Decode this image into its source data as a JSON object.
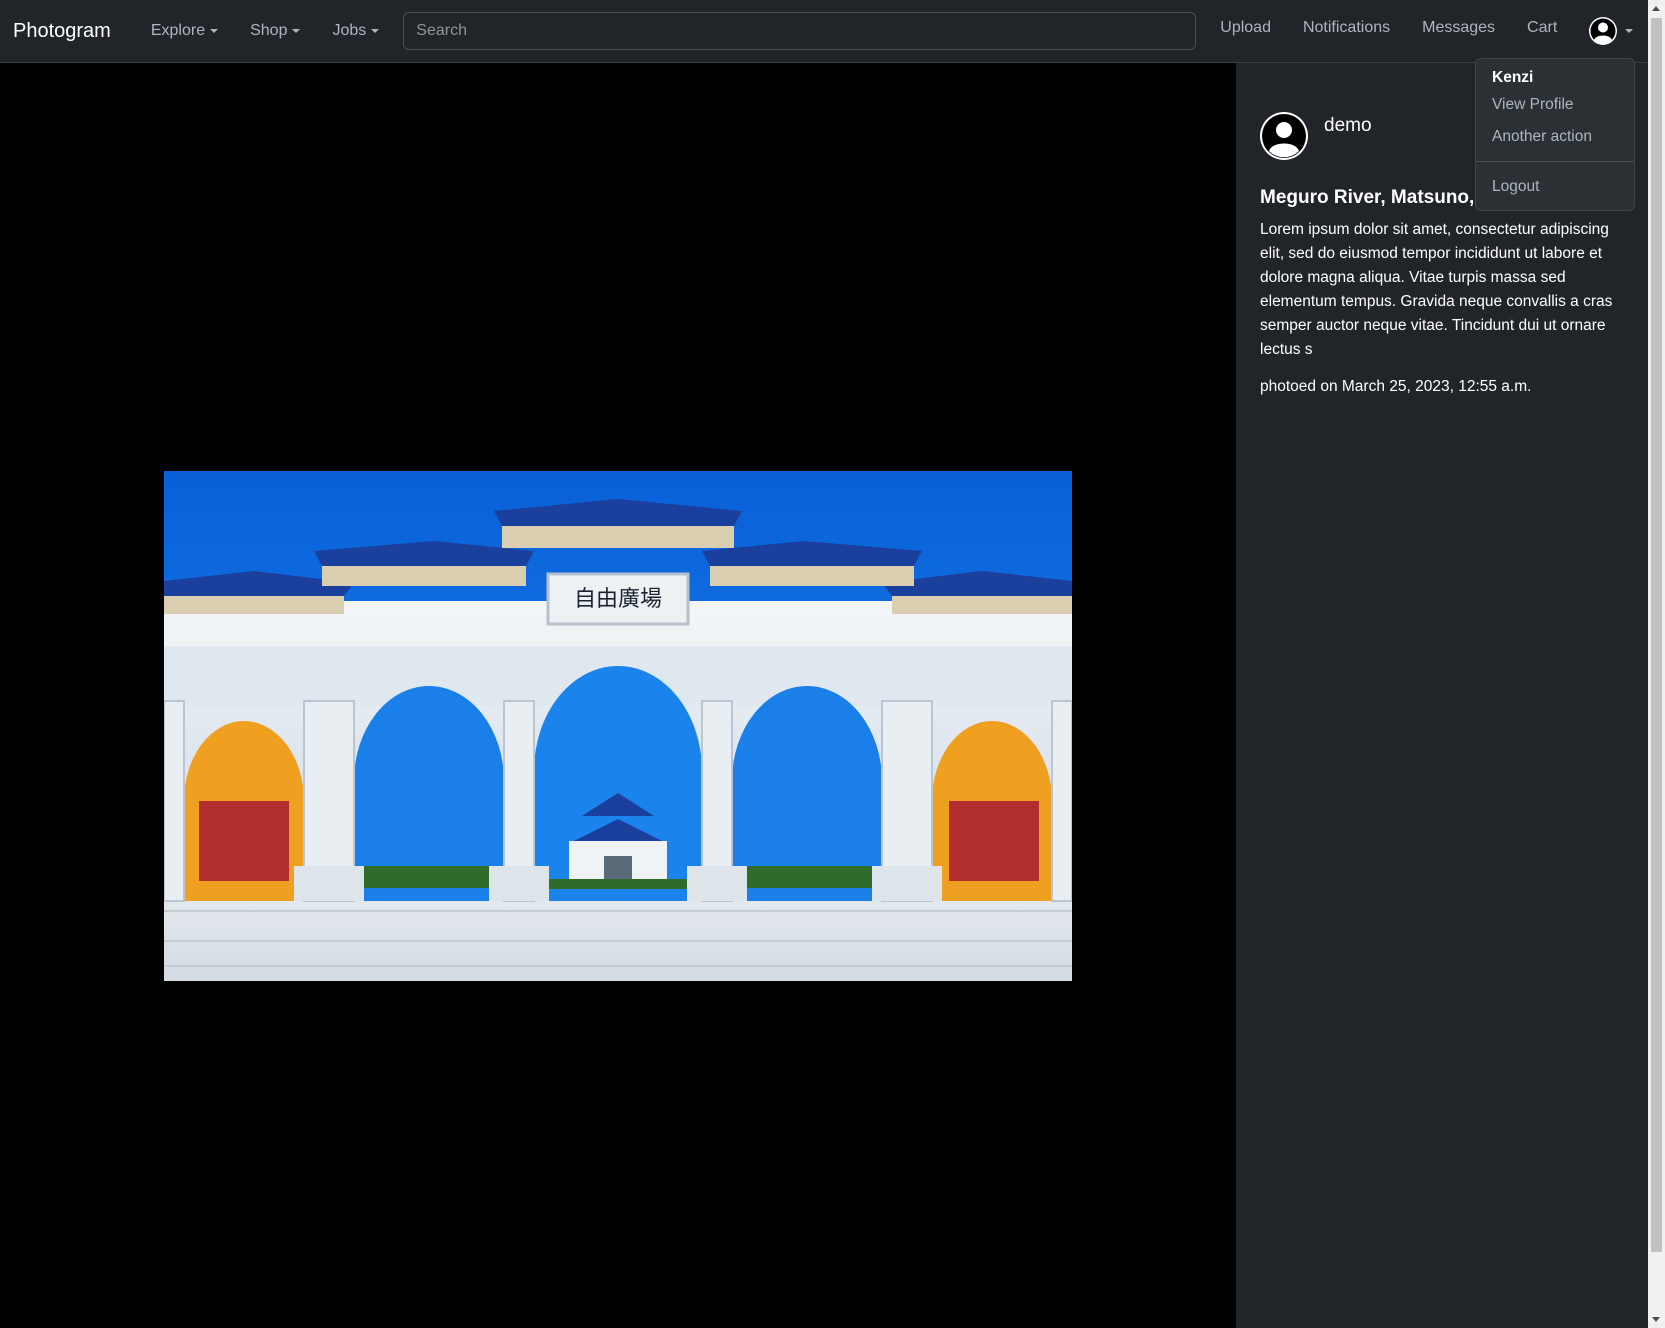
{
  "navbar": {
    "brand": "Photogram",
    "menus": [
      {
        "label": "Explore"
      },
      {
        "label": "Shop"
      },
      {
        "label": "Jobs"
      }
    ],
    "search": {
      "placeholder": "Search",
      "value": ""
    },
    "links": [
      {
        "label": "Upload"
      },
      {
        "label": "Notifications"
      },
      {
        "label": "Messages"
      },
      {
        "label": "Cart"
      }
    ],
    "avatar_icon": "user-circle-icon"
  },
  "user_dropdown": {
    "username": "Kenzi",
    "items": [
      "View Profile",
      "Another action"
    ],
    "logout": "Logout"
  },
  "photo": {
    "subject": "Chinese memorial gate with arches under blue sky",
    "inscription": "自由廣場"
  },
  "sidebar": {
    "author": "demo",
    "author_icon": "user-circle-icon",
    "title": "Meguro River, Matsuno, Japan",
    "description": "Lorem ipsum dolor sit amet, consectetur adipiscing elit, sed do eiusmod tempor incididunt ut labore et dolore magna aliqua. Vitae turpis massa sed elementum tempus. Gravida neque convallis a cras semper auctor neque vitae. Tincidunt dui ut ornare lectus s",
    "date": "photoed on March 25, 2023, 12:55 a.m."
  },
  "colors": {
    "navbar_bg": "#212529",
    "sidebar_bg": "#212529",
    "stage_bg": "#000000",
    "sky": "#0a6fe0"
  }
}
